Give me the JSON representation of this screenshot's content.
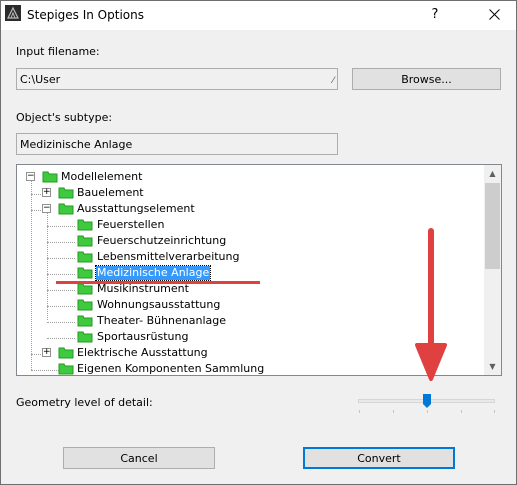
{
  "window": {
    "title": "Stepiges In Options",
    "help_glyph": "?",
    "close_label": "close"
  },
  "input_filename": {
    "label": "Input filename:",
    "value": "C:\\User",
    "grip": "⁄",
    "browse_label": "Browse..."
  },
  "subtype": {
    "label": "Object's subtype:",
    "value": "Medizinische Anlage"
  },
  "tree": {
    "nodes": [
      {
        "label": "Modellelement",
        "expander": "−",
        "selected": false
      },
      {
        "label": "Bauelement",
        "expander": "+",
        "selected": false
      },
      {
        "label": "Ausstattungselement",
        "expander": "−",
        "selected": false
      },
      {
        "label": "Feuerstellen",
        "expander": "",
        "selected": false
      },
      {
        "label": "Feuerschutzeinrichtung",
        "expander": "",
        "selected": false
      },
      {
        "label": "Lebensmittelverarbeitung",
        "expander": "",
        "selected": false
      },
      {
        "label": "Medizinische Anlage",
        "expander": "",
        "selected": true
      },
      {
        "label": "Musikinstrument",
        "expander": "",
        "selected": false
      },
      {
        "label": "Wohnungsausstattung",
        "expander": "",
        "selected": false
      },
      {
        "label": "Theater- Bühnenanlage",
        "expander": "",
        "selected": false
      },
      {
        "label": "Sportausrüstung",
        "expander": "",
        "selected": false
      },
      {
        "label": "Elektrische Ausstattung",
        "expander": "+",
        "selected": false
      },
      {
        "label": "Eigenen Komponenten Sammlung",
        "expander": "",
        "selected": false
      }
    ],
    "scroll_up": "▲",
    "scroll_down": "▼"
  },
  "geometry": {
    "label": "Geometry level of detail:",
    "level_fraction": 0.5
  },
  "buttons": {
    "cancel": "Cancel",
    "convert": "Convert"
  },
  "colors": {
    "selection": "#3399ff",
    "annotation": "#e04040",
    "folder_green": "#3ec93e",
    "default_button_border": "#0078d7"
  }
}
